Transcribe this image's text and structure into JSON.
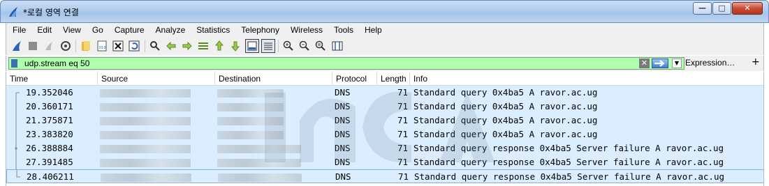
{
  "window": {
    "title": "*로컬 영역 연결",
    "buttons": {
      "minimize": "—",
      "maximize": "□",
      "close": "✕"
    }
  },
  "menu": [
    "File",
    "Edit",
    "View",
    "Go",
    "Capture",
    "Analyze",
    "Statistics",
    "Telephony",
    "Wireless",
    "Tools",
    "Help"
  ],
  "toolbar": {
    "icons": [
      "shark-fin-start-icon",
      "stop-capture-icon",
      "restart-capture-icon",
      "capture-options-icon",
      "open-file-icon",
      "save-file-icon",
      "close-file-icon",
      "reload-file-icon",
      "find-packet-icon",
      "go-back-icon",
      "go-forward-icon",
      "go-to-packet-icon",
      "go-first-icon",
      "go-last-icon",
      "auto-scroll-icon",
      "colorize-icon",
      "zoom-in-icon",
      "zoom-out-icon",
      "zoom-normal-icon",
      "resize-columns-icon"
    ]
  },
  "filter": {
    "value": "udp.stream eq 50",
    "expression_label": "Expression…",
    "add_label": "+"
  },
  "columns": [
    "Time",
    "Source",
    "Destination",
    "Protocol",
    "Length",
    "Info"
  ],
  "packets": [
    {
      "time": "19.352046",
      "protocol": "DNS",
      "length": "71",
      "info": "Standard query 0x4ba5 A ravor.ac.ug"
    },
    {
      "time": "20.360171",
      "protocol": "DNS",
      "length": "71",
      "info": "Standard query 0x4ba5 A ravor.ac.ug"
    },
    {
      "time": "21.375871",
      "protocol": "DNS",
      "length": "71",
      "info": "Standard query 0x4ba5 A ravor.ac.ug"
    },
    {
      "time": "23.383820",
      "protocol": "DNS",
      "length": "71",
      "info": "Standard query 0x4ba5 A ravor.ac.ug"
    },
    {
      "time": "26.388884",
      "protocol": "DNS",
      "length": "71",
      "info": "Standard query response 0x4ba5 Server failure A ravor.ac.ug"
    },
    {
      "time": "27.391485",
      "protocol": "DNS",
      "length": "71",
      "info": "Standard query response 0x4ba5 Server failure A ravor.ac.ug"
    },
    {
      "time": "28.406211",
      "protocol": "DNS",
      "length": "71",
      "info": "Standard query response 0x4ba5 Server failure A ravor.ac.ug"
    }
  ],
  "colors": {
    "row_bg": "#daeeff",
    "filter_valid": "#afffaf"
  }
}
